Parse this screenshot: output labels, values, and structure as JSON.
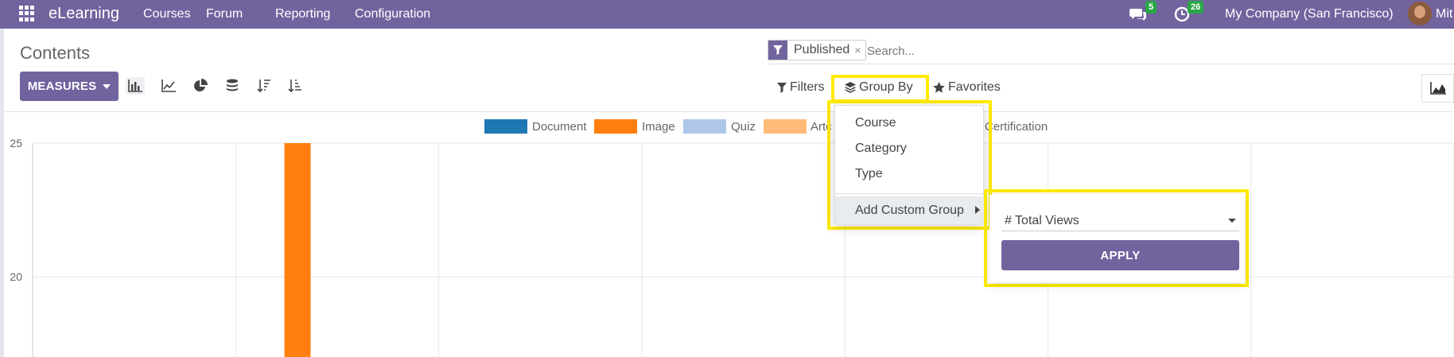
{
  "topbar": {
    "app_name": "eLearning",
    "menu": [
      "Courses",
      "Forum",
      "Reporting",
      "Configuration"
    ],
    "messages_count": "5",
    "activities_count": "26",
    "company": "My Company (San Francisco)",
    "user_short": "Mit"
  },
  "page": {
    "title": "Contents"
  },
  "search": {
    "facet_label": "Published",
    "facet_close": "×",
    "placeholder": "Search..."
  },
  "toolbar": {
    "measures_label": "MEASURES",
    "filters_label": "Filters",
    "group_by_label": "Group By",
    "favorites_label": "Favorites"
  },
  "group_by_menu": {
    "items": [
      "Course",
      "Category",
      "Type"
    ],
    "custom_group_label": "Add Custom Group"
  },
  "custom_group": {
    "selected_field": "# Total Views",
    "apply_label": "APPLY"
  },
  "colors": {
    "brand": "#71639e",
    "highlight": "#ffeb00",
    "badge": "#28a745"
  },
  "chart_data": {
    "type": "bar",
    "legend": [
      {
        "name": "Document",
        "color": "#1f77b4"
      },
      {
        "name": "Image",
        "color": "#ff7f0e"
      },
      {
        "name": "Quiz",
        "color": "#aec7e8"
      },
      {
        "name": "Artc",
        "color": "#ffbb78"
      },
      {
        "name": "Certification",
        "color": "#98df8a"
      }
    ],
    "y_ticks": [
      "25",
      "20"
    ],
    "ylim_visible": [
      17,
      25
    ],
    "series": [
      {
        "name": "Image",
        "value_exceeds": 25
      }
    ]
  }
}
